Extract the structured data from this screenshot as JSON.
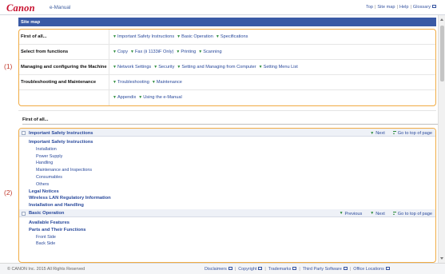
{
  "header": {
    "logo": "Canon",
    "product": "e-Manual",
    "links": [
      "Top",
      "Site map",
      "Help",
      "Glossary"
    ]
  },
  "sitemap": {
    "title": "Site map",
    "rows": [
      {
        "label": "First of all...",
        "links": [
          "Important Safety Instructions",
          "Basic Operation",
          "Specifications"
        ]
      },
      {
        "label": "Select from functions",
        "links": [
          "Copy",
          "Fax (ii 1133iF Only)",
          "Printing",
          "Scanning"
        ]
      },
      {
        "label": "Managing and configuring the Machine",
        "links": [
          "Network Settings",
          "Security",
          "Setting and Managing from Computer",
          "Setting Menu List"
        ]
      },
      {
        "label": "Troubleshooting and Maintenance",
        "links": [
          "Troubleshooting",
          "Maintenance"
        ]
      },
      {
        "label": "",
        "links": [
          "Appendix",
          "Using the e-Manual"
        ]
      }
    ]
  },
  "annotations": {
    "one": "(1)",
    "two": "(2)"
  },
  "section": {
    "title": "First of all...",
    "groups": [
      {
        "title": "Important Safety Instructions",
        "nav": [
          "Next",
          "Go to top of page"
        ],
        "items": [
          {
            "level": 2,
            "text": "Important Safety Instructions"
          },
          {
            "level": 3,
            "text": "Installation"
          },
          {
            "level": 3,
            "text": "Power Supply"
          },
          {
            "level": 3,
            "text": "Handling"
          },
          {
            "level": 3,
            "text": "Maintenance and Inspections"
          },
          {
            "level": 3,
            "text": "Consumables"
          },
          {
            "level": 3,
            "text": "Others"
          },
          {
            "level": 2,
            "text": "Legal Notices"
          },
          {
            "level": 2,
            "text": "Wireless LAN Regulatory Information"
          },
          {
            "level": 2,
            "text": "Installation and Handling"
          }
        ]
      },
      {
        "title": "Basic Operation",
        "nav": [
          "Previous",
          "Next",
          "Go to top of page"
        ],
        "items": [
          {
            "level": 2,
            "text": "Available Features"
          },
          {
            "level": 2,
            "text": "Parts and Their Functions"
          },
          {
            "level": 3,
            "text": "Front Side"
          },
          {
            "level": 3,
            "text": "Back Side"
          }
        ]
      }
    ]
  },
  "footer": {
    "copyright": "© CANON Inc. 2015 All Rights Reserved",
    "links": [
      "Disclaimers",
      "Copyright",
      "Trademarks",
      "Third Party Software",
      "Office Locations"
    ]
  },
  "colors": {
    "accent": "#3a5aa5",
    "highlight": "#f0ab44",
    "brand": "#c8102e",
    "annotation": "#c0392b"
  },
  "icons": [
    "green-down-arrow-icon",
    "go-to-top-icon",
    "external-window-icon",
    "scroll-up-icon",
    "scroll-down-icon"
  ]
}
